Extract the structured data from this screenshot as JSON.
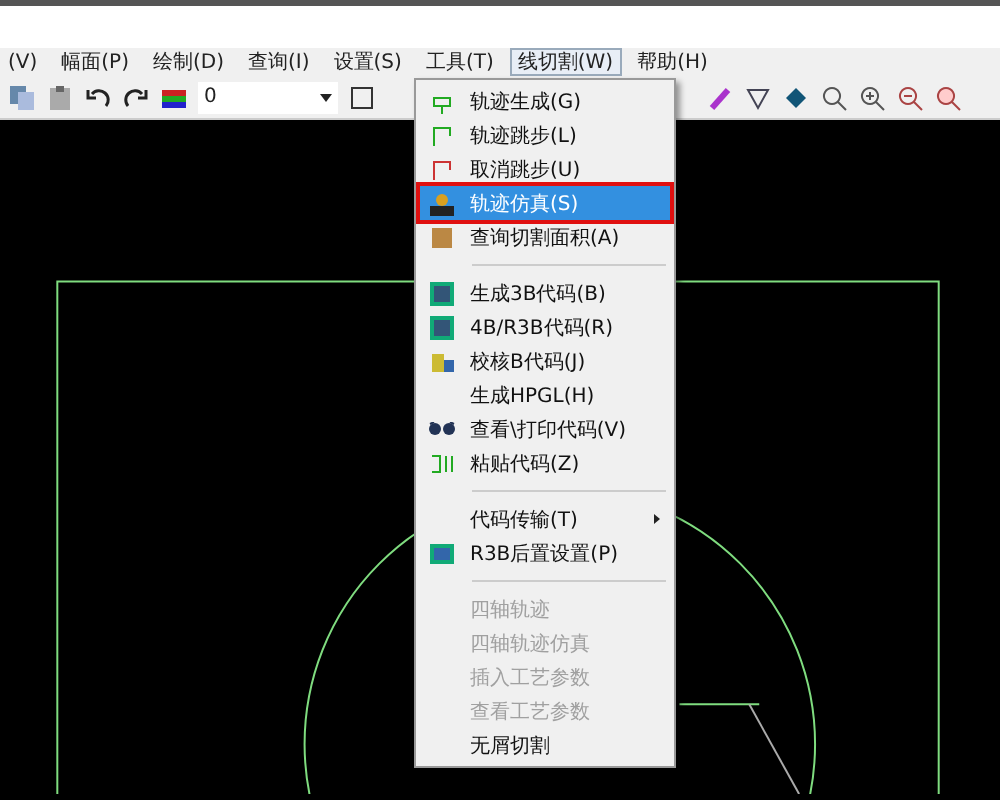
{
  "menu_bar": [
    {
      "label": "(V)",
      "selected": false
    },
    {
      "label": "幅面(P)",
      "selected": false
    },
    {
      "label": "绘制(D)",
      "selected": false
    },
    {
      "label": "查询(I)",
      "selected": false
    },
    {
      "label": "设置(S)",
      "selected": false
    },
    {
      "label": "工具(T)",
      "selected": false
    },
    {
      "label": "线切割(W)",
      "selected": true
    },
    {
      "label": "帮助(H)",
      "selected": false
    }
  ],
  "toolbar": {
    "layer_value": "0"
  },
  "dropdown": [
    {
      "kind": "item",
      "label": "轨迹生成(G)",
      "selected": false,
      "disabled": false
    },
    {
      "kind": "item",
      "label": "轨迹跳步(L)",
      "selected": false,
      "disabled": false
    },
    {
      "kind": "item",
      "label": "取消跳步(U)",
      "selected": false,
      "disabled": false
    },
    {
      "kind": "item",
      "label": "轨迹仿真(S)",
      "selected": true,
      "disabled": false
    },
    {
      "kind": "item",
      "label": "查询切割面积(A)",
      "selected": false,
      "disabled": false
    },
    {
      "kind": "separator"
    },
    {
      "kind": "item",
      "label": "生成3B代码(B)",
      "selected": false,
      "disabled": false
    },
    {
      "kind": "item",
      "label": "4B/R3B代码(R)",
      "selected": false,
      "disabled": false
    },
    {
      "kind": "item",
      "label": "校核B代码(J)",
      "selected": false,
      "disabled": false
    },
    {
      "kind": "item",
      "label": "生成HPGL(H)",
      "selected": false,
      "disabled": false
    },
    {
      "kind": "item",
      "label": "查看\\打印代码(V)",
      "selected": false,
      "disabled": false
    },
    {
      "kind": "item",
      "label": "粘贴代码(Z)",
      "selected": false,
      "disabled": false
    },
    {
      "kind": "separator"
    },
    {
      "kind": "submenu",
      "label": "代码传输(T)",
      "selected": false,
      "disabled": false
    },
    {
      "kind": "item",
      "label": "R3B后置设置(P)",
      "selected": false,
      "disabled": false
    },
    {
      "kind": "separator"
    },
    {
      "kind": "item",
      "label": "四轴轨迹",
      "selected": false,
      "disabled": true
    },
    {
      "kind": "item",
      "label": "四轴轨迹仿真",
      "selected": false,
      "disabled": true
    },
    {
      "kind": "item",
      "label": "插入工艺参数",
      "selected": false,
      "disabled": true
    },
    {
      "kind": "item",
      "label": "查看工艺参数",
      "selected": false,
      "disabled": true
    },
    {
      "kind": "item",
      "label": "无屑切割",
      "selected": false,
      "disabled": false
    }
  ]
}
